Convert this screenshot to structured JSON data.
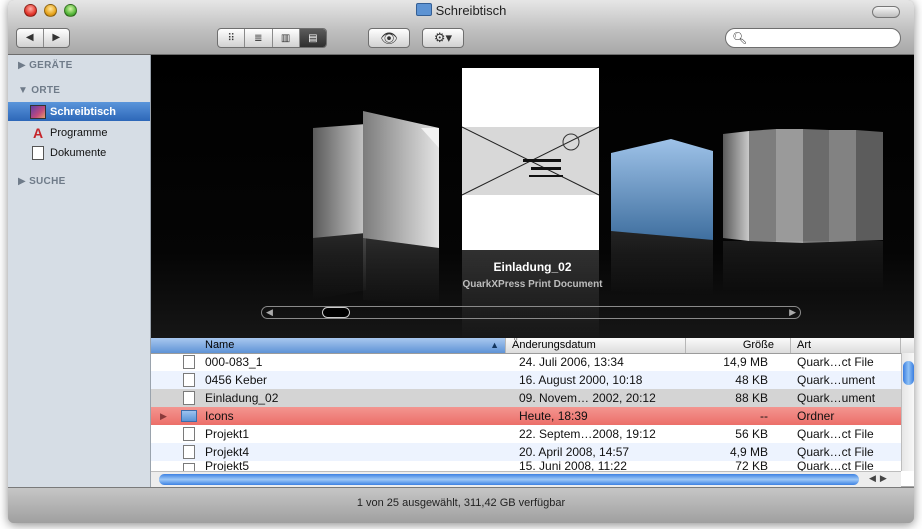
{
  "window": {
    "title": "Schreibtisch"
  },
  "toolbar": {
    "back_label": "◀",
    "forward_label": "▶",
    "view_icons": "⠿",
    "view_list": "≣",
    "view_columns": "▥",
    "view_coverflow": "▤",
    "quicklook_label": "👁",
    "action_label": "⚙▾",
    "search_placeholder": ""
  },
  "sidebar": {
    "devices_heading": "▶ GERÄTE",
    "places_heading": "▼ ORTE",
    "search_heading": "▶ SUCHE",
    "items": [
      {
        "label": "Schreibtisch",
        "icon": "desktop-icon",
        "selected": true
      },
      {
        "label": "Programme",
        "icon": "applications-icon",
        "selected": false
      },
      {
        "label": "Dokumente",
        "icon": "documents-icon",
        "selected": false
      }
    ]
  },
  "coverflow": {
    "title": "Einladung_02",
    "subtitle": "QuarkXPress Print Document"
  },
  "list": {
    "columns": {
      "name": "Name",
      "date": "Änderungsdatum",
      "size": "Größe",
      "kind": "Art"
    },
    "rows": [
      {
        "name": "000-083_1",
        "date": "24. Juli 2006, 13:34",
        "size": "14,9 MB",
        "kind": "Quark…ct File",
        "icon": "document-icon"
      },
      {
        "name": "0456 Keber",
        "date": "16. August 2000, 10:18",
        "size": "48 KB",
        "kind": "Quark…ument",
        "icon": "document-icon"
      },
      {
        "name": "Einladung_02",
        "date": "09. Novem… 2002, 20:12",
        "size": "88 KB",
        "kind": "Quark…ument",
        "icon": "document-icon"
      },
      {
        "name": "Icons",
        "date": "Heute, 18:39",
        "size": "--",
        "kind": "Ordner",
        "icon": "folder-icon"
      },
      {
        "name": "Projekt1",
        "date": "22. Septem…2008, 19:12",
        "size": "56 KB",
        "kind": "Quark…ct File",
        "icon": "document-icon"
      },
      {
        "name": "Projekt4",
        "date": "20. April 2008, 14:57",
        "size": "4,9 MB",
        "kind": "Quark…ct File",
        "icon": "document-icon"
      },
      {
        "name": "Projekt5",
        "date": "15. Juni 2008, 11:22",
        "size": "72 KB",
        "kind": "Quark…ct File",
        "icon": "document-icon"
      }
    ]
  },
  "status": {
    "text": "1 von 25 ausgewählt, 311,42 GB verfügbar"
  },
  "colors": {
    "selection": "#3d78cf",
    "label_red": "#ee7a74",
    "alt_row": "#edf3fe"
  }
}
